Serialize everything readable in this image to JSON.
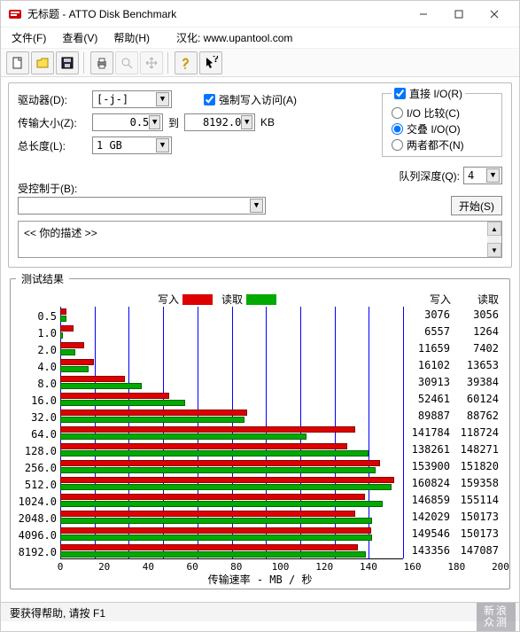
{
  "window": {
    "title": "无标题 - ATTO Disk Benchmark"
  },
  "menus": {
    "file": "文件(F)",
    "view": "查看(V)",
    "help": "帮助(H)",
    "credit": "汉化: www.upantool.com"
  },
  "labels": {
    "drive": "驱动器(D):",
    "drive_val": "[-j-]",
    "xfer": "传输大小(Z):",
    "xfer_from": "0.5",
    "to": "到",
    "xfer_to": "8192.0",
    "unit": "KB",
    "length": "总长度(L):",
    "length_val": "1 GB",
    "force_write": "强制写入访问(A)",
    "direct_io": "直接 I/O(R)",
    "io_compare": "I/O 比较(C)",
    "overlap_io": "交叠 I/O(O)",
    "neither": "两者都不(N)",
    "queue_depth": "队列深度(Q):",
    "queue_val": "4",
    "controlled": "受控制于(B):",
    "start": "开始(S)",
    "desc": "<<  你的描述   >>",
    "results": "测试结果",
    "write": "写入",
    "read": "读取",
    "xaxis": "传输速率 - MB / 秒",
    "status": "要获得帮助, 请按 F1",
    "wm1": "新浪",
    "wm2": "众测"
  },
  "chart_data": {
    "type": "bar",
    "title": "测试结果",
    "xlabel": "传输速率 - MB / 秒",
    "ylabel": "",
    "xlim": [
      0,
      200
    ],
    "xticks": [
      0,
      20,
      40,
      60,
      80,
      100,
      120,
      140,
      160,
      180,
      200
    ],
    "categories": [
      "0.5",
      "1.0",
      "2.0",
      "4.0",
      "8.0",
      "16.0",
      "32.0",
      "64.0",
      "128.0",
      "256.0",
      "512.0",
      "1024.0",
      "2048.0",
      "4096.0",
      "8192.0"
    ],
    "series": [
      {
        "name": "写入",
        "color": "#d00",
        "values": [
          3076,
          6557,
          11659,
          16102,
          30913,
          52461,
          89887,
          141784,
          138261,
          153900,
          160824,
          146859,
          142029,
          149546,
          143356
        ]
      },
      {
        "name": "读取",
        "color": "#0a0",
        "values": [
          3056,
          1264,
          7402,
          13653,
          39384,
          60124,
          88762,
          118724,
          148271,
          151820,
          159358,
          155114,
          150173,
          150173,
          147087
        ]
      }
    ],
    "display_max": 165000
  }
}
